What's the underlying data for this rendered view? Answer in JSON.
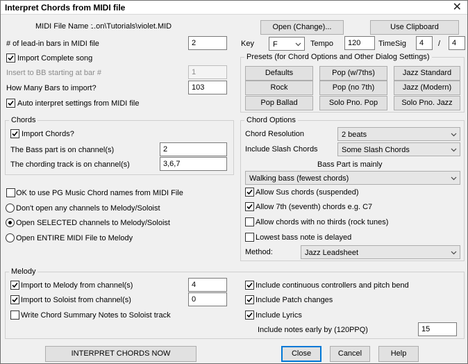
{
  "window": {
    "title": "Interpret Chords from MIDI file",
    "close": "✕"
  },
  "file": {
    "label": "MIDI File Name :",
    "path": "..on\\Tutorials\\violet.MID",
    "open_button": "Open (Change)...",
    "clipboard_button": "Use Clipboard"
  },
  "leadin": {
    "label": "# of lead-in bars in MIDI file",
    "value": "2"
  },
  "import_complete": {
    "label": "Import Complete song",
    "checked": true
  },
  "insert_bar": {
    "label": "Insert to BB starting at bar #",
    "value": "1"
  },
  "how_many": {
    "label": "How Many Bars to import?",
    "value": "103"
  },
  "auto_interpret": {
    "label": "Auto interpret settings from MIDI file",
    "checked": true
  },
  "key": {
    "label": "Key",
    "value": "F"
  },
  "tempo": {
    "label": "Tempo",
    "value": "120"
  },
  "timesig": {
    "label": "TimeSig",
    "num": "4",
    "slash": "/",
    "den": "4"
  },
  "presets": {
    "title": "Presets  (for Chord Options and Other Dialog Settings)",
    "buttons": [
      "Defaults",
      "Pop (w/7ths)",
      "Jazz Standard",
      "Rock",
      "Pop (no 7th)",
      "Jazz (Modern)",
      "Pop Ballad",
      "Solo Pno. Pop",
      "Solo Pno. Jazz"
    ]
  },
  "chords": {
    "title": "Chords",
    "import_label": "Import Chords?",
    "import_checked": true,
    "bass_label": "The Bass part is on channel(s)",
    "bass_value": "2",
    "chording_label": "The chording track is on channel(s)",
    "chording_value": "3,6,7"
  },
  "pg_names": {
    "label": "OK to use PG Music Chord names from MIDI File",
    "checked": false
  },
  "radios": [
    {
      "label": "Don't open any channels to Melody/Soloist",
      "selected": false
    },
    {
      "label": "Open SELECTED channels to Melody/Soloist",
      "selected": true
    },
    {
      "label": "Open ENTIRE MIDI File to Melody",
      "selected": false
    }
  ],
  "chord_options": {
    "title": "Chord Options",
    "resolution_label": "Chord Resolution",
    "resolution_value": "2 beats",
    "slash_label": "Include Slash Chords",
    "slash_value": "Some Slash Chords",
    "bass_mainly_label": "Bass Part is mainly",
    "bass_mainly_value": "Walking bass (fewest chords)",
    "sus": {
      "label": "Allow Sus chords (suspended)",
      "checked": true
    },
    "seventh": {
      "label": "Allow 7th (seventh) chords e.g. C7",
      "checked": true
    },
    "no_thirds": {
      "label": "Allow chords with no thirds (rock tunes)",
      "checked": false
    },
    "lowest_bass": {
      "label": "Lowest bass note is delayed",
      "checked": false
    },
    "method_label": "Method:",
    "method_value": "Jazz Leadsheet"
  },
  "melody": {
    "title": "Melody",
    "import_melody": {
      "label": "Import to Melody from channel(s)",
      "checked": true,
      "value": "4"
    },
    "import_soloist": {
      "label": "Import to Soloist from channel(s)",
      "checked": true,
      "value": "0"
    },
    "write_summary": {
      "label": "Write Chord Summary Notes to Soloist track",
      "checked": false
    },
    "continuous": {
      "label": "Include continuous controllers and pitch bend",
      "checked": true
    },
    "patch": {
      "label": "Include Patch changes",
      "checked": true
    },
    "lyrics": {
      "label": "Include Lyrics",
      "checked": true
    },
    "early_label": "Include notes early by (120PPQ)",
    "early_value": "15"
  },
  "footer": {
    "interpret": "INTERPRET CHORDS NOW",
    "close": "Close",
    "cancel": "Cancel",
    "help": "Help"
  }
}
